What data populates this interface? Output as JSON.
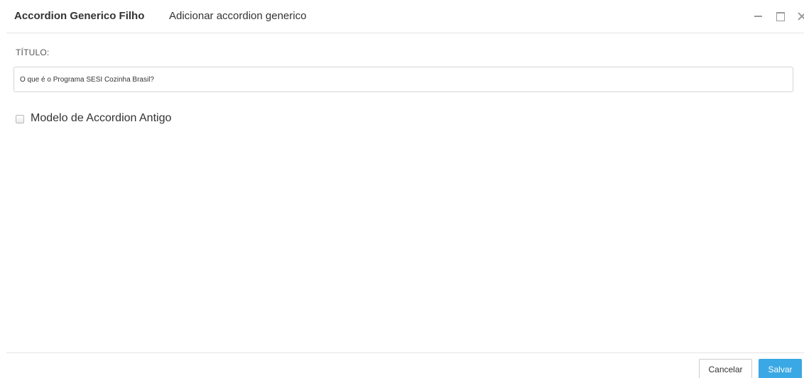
{
  "dialog": {
    "title": "Accordion Generico Filho",
    "subtitle": "Adicionar accordion generico",
    "controls": {
      "minimize_icon": "minimize-icon",
      "maximize_icon": "maximize-icon",
      "close_icon": "close-icon"
    }
  },
  "form": {
    "title_label": "TÍTULO:",
    "title_value": "O que é o Programa SESI Cozinha Brasil?",
    "checkbox_label": "Modelo de Accordion Antigo",
    "checkbox_checked": false
  },
  "footer": {
    "cancel_label": "Cancelar",
    "save_label": "Salvar"
  },
  "colors": {
    "accent": "#3aa8e4",
    "border": "#e5e5e5"
  }
}
